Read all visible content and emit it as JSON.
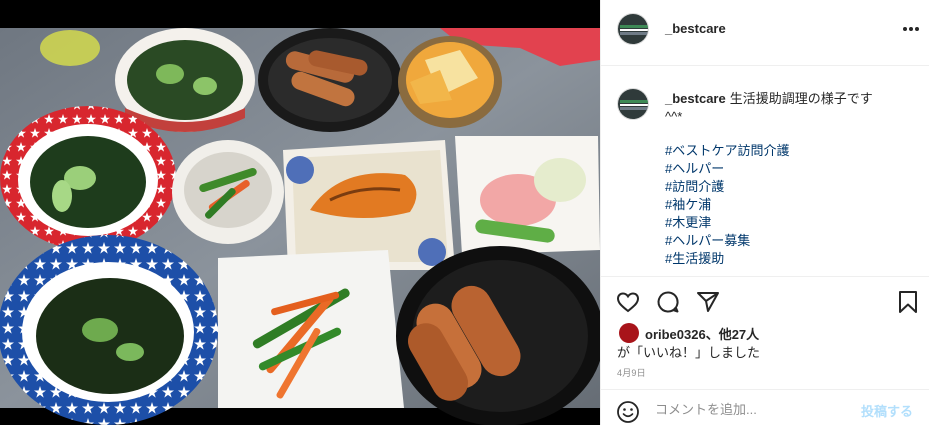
{
  "post": {
    "username": "_bestcare",
    "image_alt": "Instagram post photo of home-cooked dishes",
    "caption": {
      "username": "_bestcare",
      "text_line1": "生活援助調理の様子です",
      "text_line2": "^^*",
      "hashtags": [
        "#ベストケア訪問介護",
        "#ヘルパー",
        "#訪問介護",
        "#袖ケ浦",
        "#木更津",
        "#ヘルパー募集",
        "#生活援助"
      ]
    },
    "likes": {
      "first_liker": "oribe0326",
      "others_text": "、他27人",
      "suffix_line": "が「いいね！」しました"
    },
    "date": "4月9日",
    "comment": {
      "placeholder": "コメントを追加...",
      "post_label": "投稿する"
    }
  },
  "icons": {
    "more": "more-options-icon",
    "like": "heart-icon",
    "comment": "comment-bubble-icon",
    "share": "paper-plane-icon",
    "save": "bookmark-icon",
    "emoji": "emoji-smile-icon"
  },
  "colors": {
    "hashtag": "#00376b",
    "post_button_disabled": "#b2dffc",
    "muted": "#8e8e8e",
    "liker_avatar": "#a8141a"
  }
}
